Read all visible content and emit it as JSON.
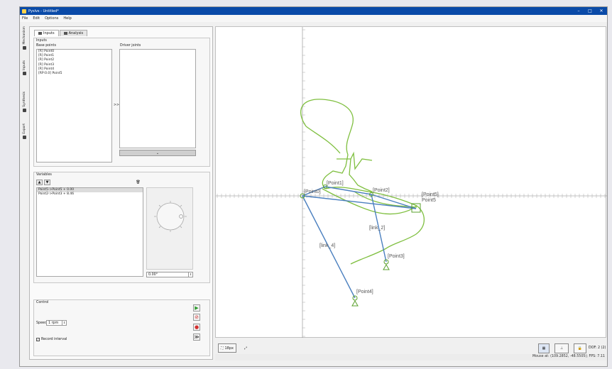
{
  "window": {
    "title": "Pyslvs - Untitled*",
    "controls": [
      "–",
      "□",
      "✕"
    ]
  },
  "menus": [
    "File",
    "Edit",
    "Options",
    "Help"
  ],
  "side_tabs": [
    {
      "label": "Mechanism",
      "icon": "gear-icon"
    },
    {
      "label": "Inputs",
      "icon": "play-icon"
    },
    {
      "label": "Synthesis",
      "icon": "bars-icon"
    },
    {
      "label": "Export",
      "icon": "export-icon"
    }
  ],
  "inputs_panel": {
    "tabs": [
      {
        "label": "Inputs",
        "active": true
      },
      {
        "label": "Analysis",
        "active": false
      }
    ],
    "group_title": "Inputs",
    "base_points_label": "Base points",
    "driver_joints_label": "Driver joints",
    "base_points": [
      "[R] Point0",
      "[R] Point1",
      "[R] Point2",
      "[R] Point3",
      "[R] Point4",
      "[RP:0.0] Point5"
    ],
    "arrow": ">>",
    "variables_label": "Variables",
    "variables": [
      "Point5->Point5 + 0.00",
      "Point2->Point3 + 8.46"
    ],
    "dial_value": "0.00°",
    "control_label": "Control",
    "speed_label": "Speed",
    "speed_value": "1 rpm",
    "record_label": "Record interval"
  },
  "canvas": {
    "labels": [
      "[Point0]",
      "[Point1]",
      "[Point2]",
      "[Point5]",
      "Point5",
      "[link_2]",
      "[link_4]",
      "[Point3]",
      "[Point4]"
    ]
  },
  "bottom": {
    "zoom_label": "18px",
    "dof_label": "DOF: 2 (2)",
    "status": "Mouse at: (109.2852, -48.5505); FPS: 7.11"
  },
  "colors": {
    "link": "#4a7fbf",
    "path": "#7fbf3f",
    "joint": "#5aa02c",
    "titlebar": "#0a4aa8"
  }
}
